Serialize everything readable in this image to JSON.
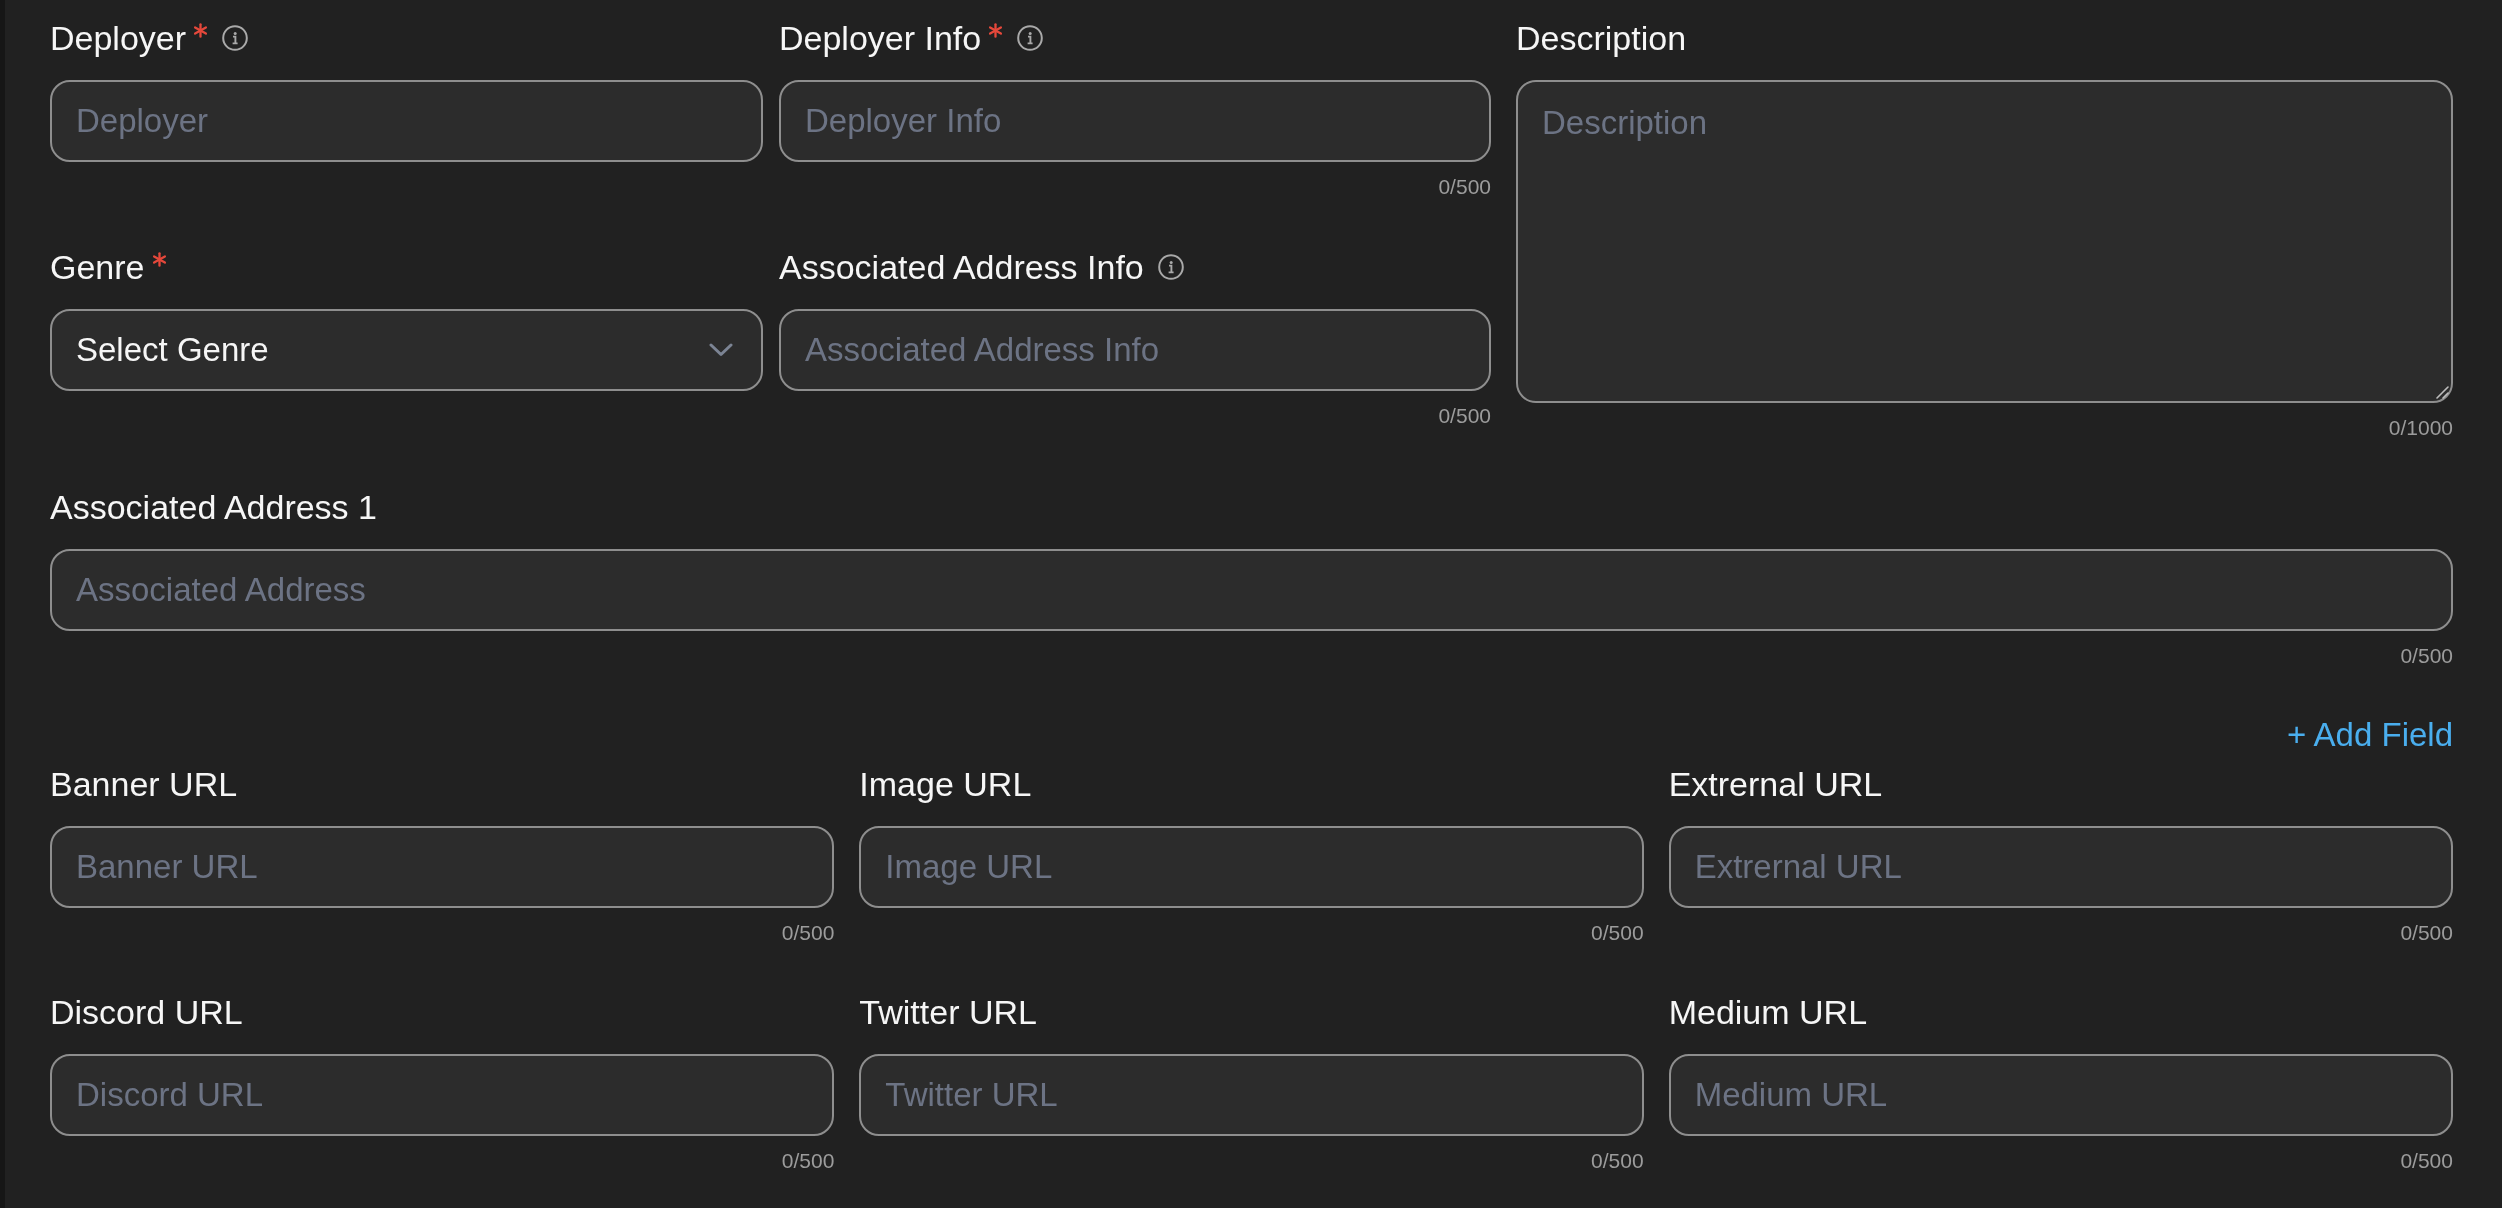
{
  "form": {
    "top_fields": [
      {
        "kind": "input",
        "label": "Deployer",
        "required": true,
        "info": true,
        "placeholder": "Deployer"
      },
      {
        "kind": "input",
        "label": "Deployer Info",
        "required": true,
        "info": true,
        "placeholder": "Deployer Info",
        "counter": "0/500"
      },
      {
        "kind": "select",
        "label": "Genre",
        "required": true,
        "info": false,
        "value": "Select Genre"
      },
      {
        "kind": "input",
        "label": "Associated Address Info",
        "required": false,
        "info": true,
        "placeholder": "Associated Address Info",
        "counter": "0/500"
      }
    ],
    "description": {
      "kind": "textarea",
      "label": "Description",
      "required": false,
      "info": false,
      "placeholder": "Description",
      "counter": "0/1000"
    },
    "address_fields": [
      {
        "kind": "input",
        "label": "Associated Address 1",
        "required": false,
        "info": false,
        "placeholder": "Associated Address",
        "counter": "0/500"
      }
    ],
    "add_field_link": "+ Add Field",
    "url_fields": [
      {
        "kind": "input",
        "label": "Banner URL",
        "required": false,
        "info": false,
        "placeholder": "Banner URL",
        "counter": "0/500"
      },
      {
        "kind": "input",
        "label": "Image URL",
        "required": false,
        "info": false,
        "placeholder": "Image URL",
        "counter": "0/500"
      },
      {
        "kind": "input",
        "label": "Extrernal URL",
        "required": false,
        "info": false,
        "placeholder": "Extrernal URL",
        "counter": "0/500"
      },
      {
        "kind": "input",
        "label": "Discord URL",
        "required": false,
        "info": false,
        "placeholder": "Discord URL",
        "counter": "0/500"
      },
      {
        "kind": "input",
        "label": "Twitter URL",
        "required": false,
        "info": false,
        "placeholder": "Twitter URL",
        "counter": "0/500"
      },
      {
        "kind": "input",
        "label": "Medium URL",
        "required": false,
        "info": false,
        "placeholder": "Medium URL",
        "counter": "0/500"
      }
    ]
  }
}
